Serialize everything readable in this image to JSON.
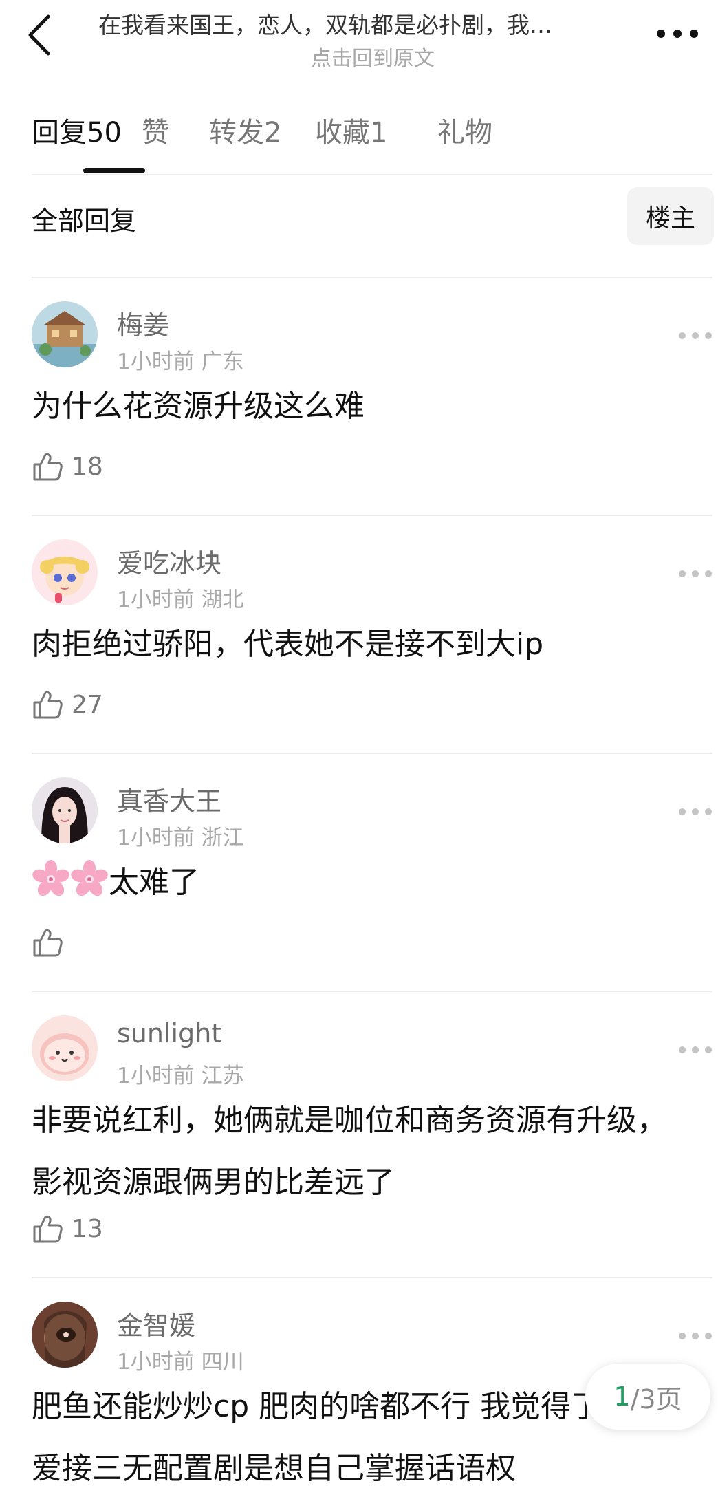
{
  "header": {
    "title": "在我看来国王，恋人，双轨都是必扑剧，我…",
    "subtitle": "点击回到原文"
  },
  "tabs": [
    {
      "label": "回复",
      "count": "50"
    },
    {
      "label": "赞",
      "count": ""
    },
    {
      "label": "转发",
      "count": "2"
    },
    {
      "label": "收藏",
      "count": "1"
    },
    {
      "label": "礼物",
      "count": ""
    }
  ],
  "filter": {
    "label": "全部回复",
    "op_button": "楼主"
  },
  "comments": [
    {
      "user": "梅姜",
      "time": "1小时前",
      "location": "广东",
      "text": "为什么花资源升级这么难",
      "likes": "18"
    },
    {
      "user": "爱吃冰块",
      "time": "1小时前",
      "location": "湖北",
      "text": "肉拒绝过骄阳，代表她不是接不到大ip",
      "likes": "27"
    },
    {
      "user": "真香大王",
      "time": "1小时前",
      "location": "浙江",
      "text": "太难了",
      "likes": ""
    },
    {
      "user": "sunlight",
      "time": "1小时前",
      "location": "江苏",
      "text": "非要说红利，她俩就是咖位和商务资源有升级，影视资源跟俩男的比差远了",
      "likes": "13"
    },
    {
      "user": "金智媛",
      "time": "1小时前",
      "location": "四川",
      "text": "肥鱼还能炒炒cp 肥肉的啥都不行 我觉得了之后爱接三无配置剧是想自己掌握话语权",
      "likes": ""
    }
  ],
  "pagination": {
    "current": "1",
    "rest": "/3页"
  },
  "icons": {
    "back": "chevron-left-icon",
    "more": "more-dots-icon",
    "like": "thumbs-up-icon",
    "emoji": "cherry-blossom-icon"
  },
  "colors": {
    "accent": "#1aa260",
    "divider": "#ececec",
    "muted": "#a8a8a8"
  }
}
